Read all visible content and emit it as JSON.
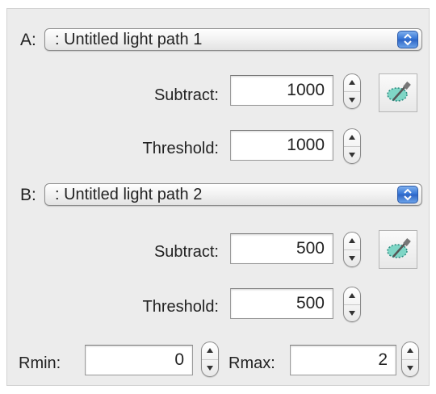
{
  "section_a": {
    "prefix": "A:",
    "popup_value": ": Untitled light path 1",
    "subtract_label": "Subtract:",
    "subtract_value": "1000",
    "threshold_label": "Threshold:",
    "threshold_value": "1000"
  },
  "section_b": {
    "prefix": "B:",
    "popup_value": ": Untitled light path 2",
    "subtract_label": "Subtract:",
    "subtract_value": "500",
    "threshold_label": "Threshold:",
    "threshold_value": "500"
  },
  "range": {
    "rmin_label": "Rmin:",
    "rmin_value": "0",
    "rmax_label": "Rmax:",
    "rmax_value": "2"
  },
  "icons": {
    "popup_arrow": "up-down-chevron-icon",
    "stepper": "up-down-stepper-icon",
    "eyedropper": "eyedropper-icon"
  },
  "colors": {
    "accent": "#2f6fd3",
    "eyedropper": "#5fc4b4"
  }
}
